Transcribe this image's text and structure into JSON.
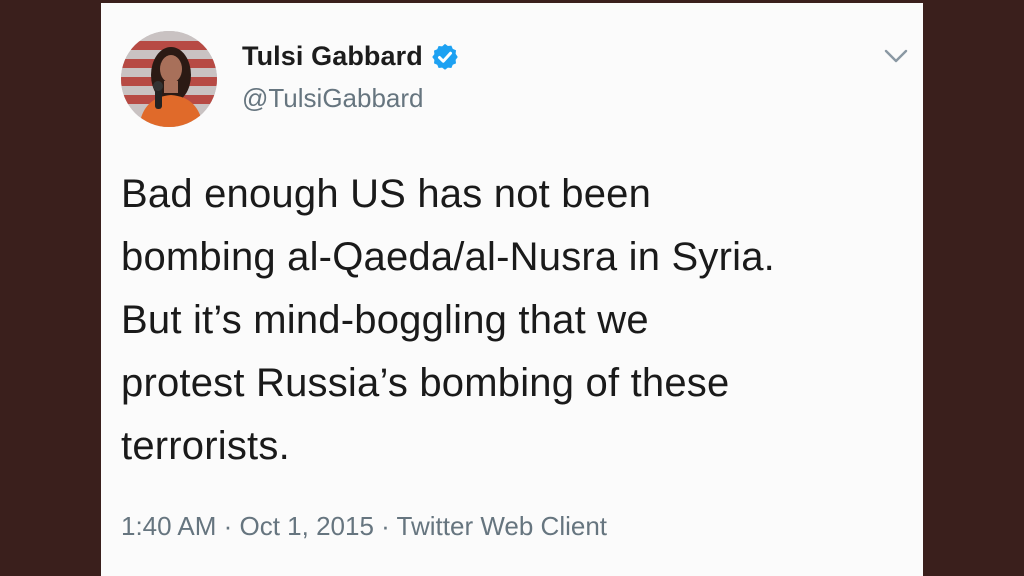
{
  "tweet": {
    "display_name": "Tulsi Gabbard",
    "handle": "@TulsiGabbard",
    "verified": true,
    "text": "Bad enough US has not been\nbombing al-Qaeda/al-Nusra in Syria.\nBut it’s mind-boggling that we\nprotest Russia’s bombing of these\nterrorists.",
    "meta_line": "1:40 AM · Oct 1, 2015 · Twitter Web Client"
  },
  "icons": {
    "verified": "verified-badge-icon",
    "menu": "chevron-down-icon"
  },
  "colors": {
    "background": "#3a1f1c",
    "card": "#fbfbfb",
    "verified_blue": "#1da1f2",
    "secondary_text": "#66757f",
    "primary_text": "#1a1a1a"
  }
}
